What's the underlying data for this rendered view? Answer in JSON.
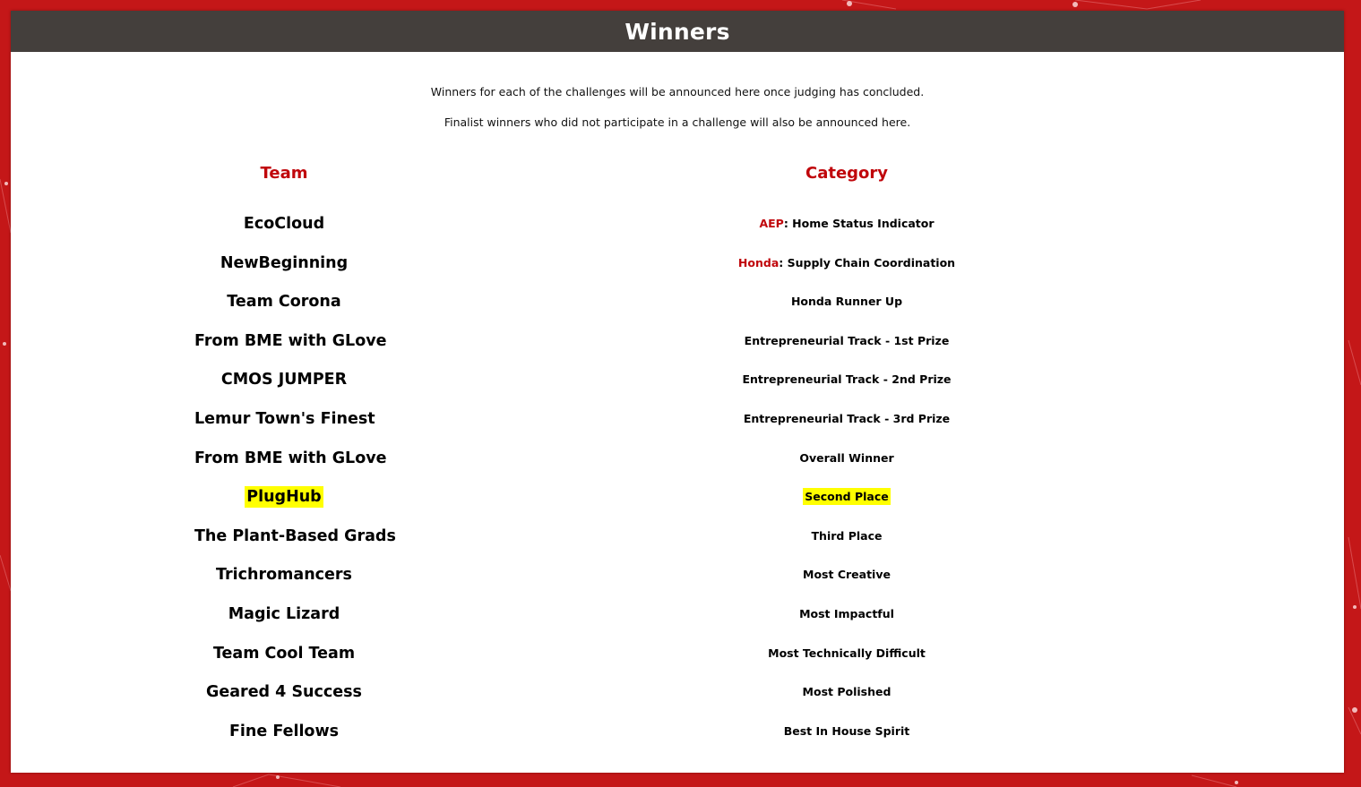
{
  "title": "Winners",
  "intro": {
    "line1": "Winners for each of the challenges will be announced here once judging has concluded.",
    "line2": "Finalist winners who did not participate in a challenge will also be announced here."
  },
  "columns": {
    "team": "Team",
    "category": "Category"
  },
  "winners": [
    {
      "team": "EcoCloud",
      "sponsor": "AEP",
      "category": ": Home Status Indicator",
      "highlighted": false
    },
    {
      "team": "NewBeginning",
      "sponsor": "Honda",
      "category": ": Supply Chain Coordination",
      "highlighted": false
    },
    {
      "team": "Team Corona",
      "sponsor": "",
      "category": "Honda Runner Up",
      "highlighted": false
    },
    {
      "team": "From BME with GLove",
      "sponsor": "",
      "category": "Entrepreneurial Track - 1st Prize",
      "highlighted": false
    },
    {
      "team": "CMOS JUMPER",
      "sponsor": "",
      "category": "Entrepreneurial Track - 2nd Prize",
      "highlighted": false
    },
    {
      "team": "Lemur Town's Finest",
      "sponsor": "",
      "category": "Entrepreneurial Track - 3rd Prize",
      "highlighted": false
    },
    {
      "team": "From BME with GLove",
      "sponsor": "",
      "category": "Overall Winner",
      "highlighted": false
    },
    {
      "team": "PlugHub",
      "sponsor": "",
      "category": "Second Place",
      "highlighted": true
    },
    {
      "team": "The Plant-Based Grads",
      "sponsor": "",
      "category": "Third Place",
      "highlighted": false
    },
    {
      "team": "Trichromancers",
      "sponsor": "",
      "category": "Most Creative",
      "highlighted": false
    },
    {
      "team": "Magic Lizard",
      "sponsor": "",
      "category": "Most Impactful",
      "highlighted": false
    },
    {
      "team": "Team Cool Team",
      "sponsor": "",
      "category": "Most Technically Difficult",
      "highlighted": false
    },
    {
      "team": "Geared 4 Success",
      "sponsor": "",
      "category": "Most Polished",
      "highlighted": false
    },
    {
      "team": "Fine Fellows",
      "sponsor": "",
      "category": "Best In House Spirit",
      "highlighted": false
    }
  ],
  "colors": {
    "background": "#c41718",
    "header": "#443f3c",
    "accent": "#c0060b",
    "highlight": "#ffff00"
  }
}
